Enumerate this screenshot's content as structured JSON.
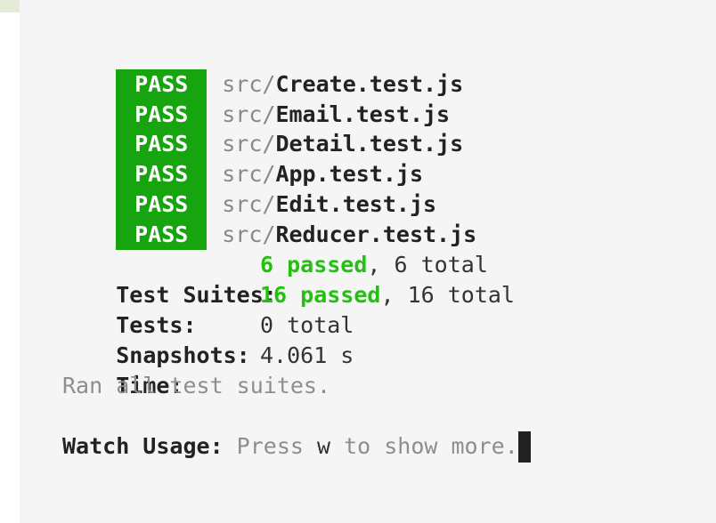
{
  "test_results": [
    {
      "status": "PASS",
      "dir": "src/",
      "file": "Create.test.js"
    },
    {
      "status": "PASS",
      "dir": "src/",
      "file": "Email.test.js"
    },
    {
      "status": "PASS",
      "dir": "src/",
      "file": "Detail.test.js"
    },
    {
      "status": "PASS",
      "dir": "src/",
      "file": "App.test.js"
    },
    {
      "status": "PASS",
      "dir": "src/",
      "file": "Edit.test.js"
    },
    {
      "status": "PASS",
      "dir": "src/",
      "file": "Reducer.test.js"
    }
  ],
  "summary": {
    "suites": {
      "label": "Test Suites:",
      "passed": "6 passed",
      "total": ", 6 total"
    },
    "tests": {
      "label": "Tests:",
      "passed": "16 passed",
      "total": ", 16 total"
    },
    "snapshots": {
      "label": "Snapshots:",
      "value": "0 total"
    },
    "time": {
      "label": "Time:",
      "value": "4.061 s"
    },
    "ran_all": "Ran all test suites."
  },
  "watch": {
    "label": "Watch Usage:",
    "press": " Press ",
    "key": "w",
    "rest": " to show more."
  },
  "colors": {
    "pass_badge": "#17a50f",
    "passed_text": "#22c10f",
    "background": "#f5f5f5"
  }
}
